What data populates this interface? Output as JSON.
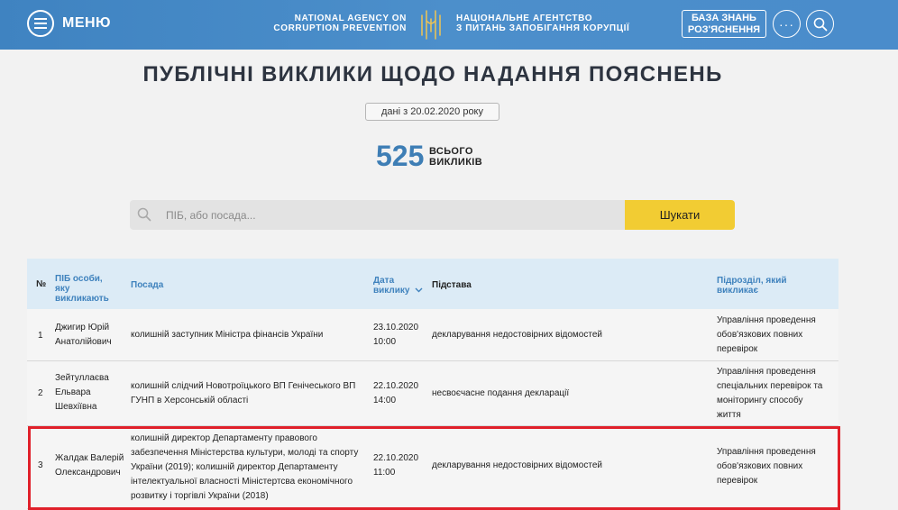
{
  "header": {
    "menu_label": "МЕНЮ",
    "agency_en": [
      "NATIONAL AGENCY ON",
      "CORRUPTION PREVENTION"
    ],
    "agency_ua": [
      "НАЦІОНАЛЬНЕ АГЕНТСТВО",
      "З ПИТАНЬ ЗАПОБІГАННЯ КОРУПЦІЇ"
    ],
    "kb_button": [
      "БАЗА ЗНАНЬ",
      "РОЗ'ЯСНЕННЯ"
    ],
    "more_label": "···"
  },
  "page": {
    "title": "ПУБЛІЧНІ ВИКЛИКИ ЩОДО НАДАННЯ ПОЯСНЕНЬ",
    "date_note": "дані з 20.02.2020 року",
    "total_count": "525",
    "total_label": [
      "ВСЬОГО",
      "ВИКЛИКІВ"
    ]
  },
  "search": {
    "placeholder": "ПІБ, або посада...",
    "value": "",
    "button_label": "Шукати"
  },
  "table": {
    "headers": {
      "num": "№",
      "name": [
        "ПІБ особи,",
        "яку",
        "викликають"
      ],
      "position": "Посада",
      "date": [
        "Дата",
        "виклику"
      ],
      "reason": "Підстава",
      "department": [
        "Підрозділ, який",
        "викликає"
      ]
    },
    "rows": [
      {
        "num": "1",
        "name": [
          "Джигир Юрій",
          "Анатолійович"
        ],
        "position": [
          "колишній заступник Міністра фінансів України"
        ],
        "date": [
          "23.10.2020",
          "10:00"
        ],
        "reason": "декларування недостовірних відомостей",
        "department": [
          "Управління проведення",
          "обов'язкових повних",
          "перевірок"
        ]
      },
      {
        "num": "2",
        "name": [
          "Зейтуллаєва",
          "Ельвара",
          "Шевхіївна"
        ],
        "position": [
          "колишній слідчий Новотроїцького ВП Генічеського ВП",
          "ГУНП в Херсонській області"
        ],
        "date": [
          "22.10.2020",
          "14:00"
        ],
        "reason": "несвоєчасне подання декларації",
        "department": [
          "Управління проведення",
          "спеціальних перевірок та",
          "моніторингу способу",
          "життя"
        ]
      },
      {
        "num": "3",
        "name": [
          "Жалдак Валерій",
          "Олександрович"
        ],
        "position": [
          "колишній директор Департаменту правового",
          "забезпечення Міністерства культури, молоді та спорту",
          "України (2019); колишній директор Департаменту",
          "інтелектуальної власності Міністертсва економічного",
          "розвитку і торгівлі України (2018)"
        ],
        "date": [
          "22.10.2020",
          "11:00"
        ],
        "reason": "декларування недостовірних відомостей",
        "department": [
          "Управління проведення",
          "обов'язкових повних",
          "перевірок"
        ]
      }
    ]
  },
  "colors": {
    "header_bg": "#4a8ccb",
    "accent_blue": "#3f82bd",
    "search_button": "#f2cc33",
    "highlight_border": "#e0202a"
  }
}
